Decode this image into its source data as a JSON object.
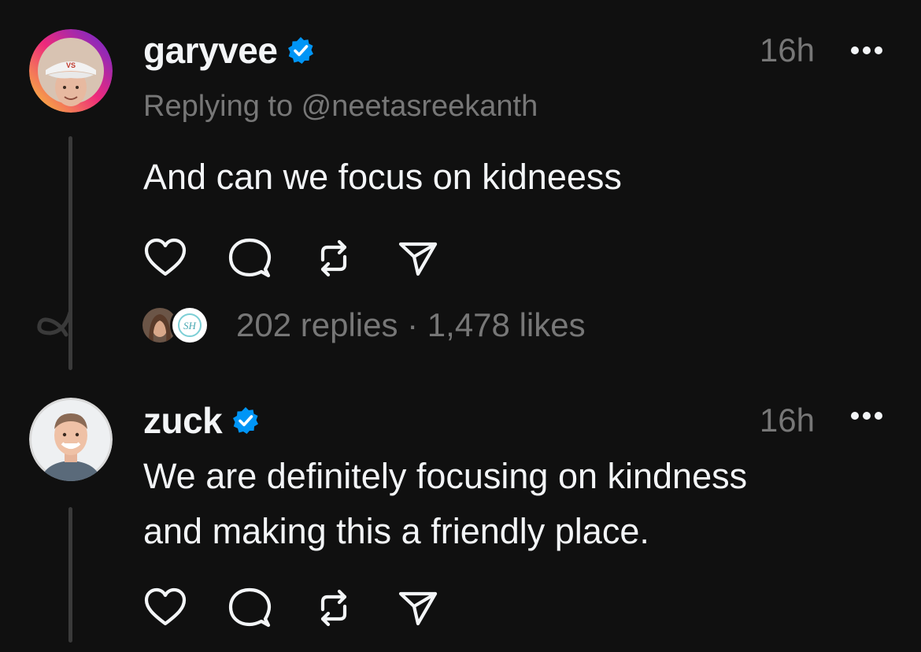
{
  "posts": [
    {
      "username": "garyvee",
      "verified": true,
      "timestamp": "16h",
      "reply_to": "Replying to @neetasreekanth",
      "text": "And can we focus on kidneess",
      "replies": "202 replies",
      "separator": " · ",
      "likes": "1,478 likes",
      "avatar_ring_colors": [
        "#f9ce34",
        "#ee2a7b",
        "#6228d7"
      ]
    },
    {
      "username": "zuck",
      "verified": true,
      "timestamp": "16h",
      "text": "We are definitely focusing on kindness\nand making this a friendly place."
    }
  ],
  "actions": [
    {
      "icon": "heart-icon",
      "label": "Like"
    },
    {
      "icon": "comment-icon",
      "label": "Reply"
    },
    {
      "icon": "repost-icon",
      "label": "Repost"
    },
    {
      "icon": "share-icon",
      "label": "Share"
    }
  ],
  "colors": {
    "background": "#101010",
    "primary_text": "#f3f5f7",
    "secondary_text": "#777777",
    "verified_blue": "#0095f6",
    "thread_line": "#3a3a3a"
  }
}
